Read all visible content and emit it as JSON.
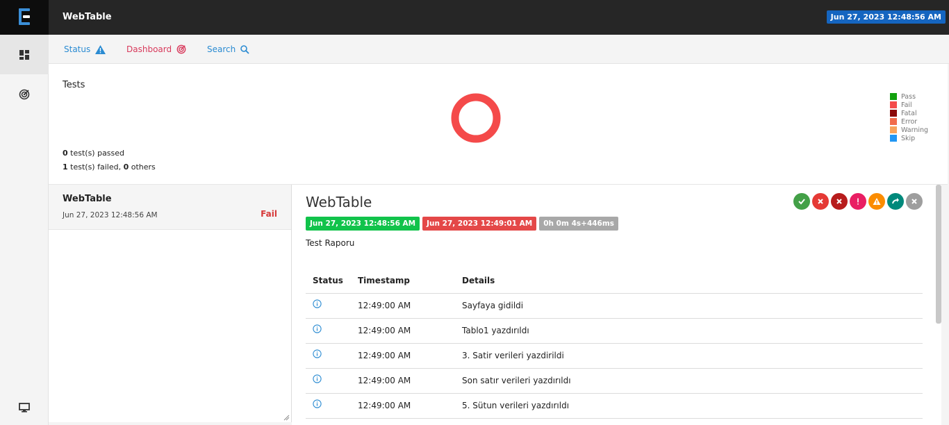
{
  "header": {
    "app_title": "WebTable",
    "date": "Jun 27, 2023 12:48:56 AM"
  },
  "sidenav": {
    "items": [
      {
        "icon": "dashboard-grid-icon",
        "active": true
      },
      {
        "icon": "radar-icon",
        "active": false
      },
      {
        "icon": "monitor-icon",
        "active": false
      }
    ]
  },
  "subnav": {
    "status_label": "Status",
    "dashboard_label": "Dashboard",
    "search_label": "Search"
  },
  "dashboard": {
    "title": "Tests",
    "passed_count": "0",
    "passed_text": " test(s) passed",
    "failed_count": "1",
    "failed_text": " test(s) failed, ",
    "others_count": "0",
    "others_text": " others",
    "legend": [
      {
        "label": "Pass",
        "color": "#13a10e"
      },
      {
        "label": "Fail",
        "color": "#f44a4a"
      },
      {
        "label": "Fatal",
        "color": "#8b0a0a"
      },
      {
        "label": "Error",
        "color": "#f16b4b"
      },
      {
        "label": "Warning",
        "color": "#f7a35c"
      },
      {
        "label": "Skip",
        "color": "#2196f3"
      }
    ],
    "chart_data": {
      "type": "pie",
      "categories": [
        "Pass",
        "Fail",
        "Fatal",
        "Error",
        "Warning",
        "Skip"
      ],
      "values": [
        0,
        1,
        0,
        0,
        0,
        0
      ]
    }
  },
  "test_list": {
    "items": [
      {
        "name": "WebTable",
        "time": "Jun 27, 2023 12:48:56 AM",
        "status": "Fail"
      }
    ]
  },
  "detail": {
    "title": "WebTable",
    "start_time": "Jun 27, 2023 12:48:56 AM",
    "end_time": "Jun 27, 2023 12:49:01 AM",
    "duration": "0h 0m 4s+446ms",
    "description": "Test Raporu",
    "filters": [
      {
        "name": "pass-filter",
        "color": "#43a047",
        "icon": "check"
      },
      {
        "name": "fail-filter",
        "color": "#e53935",
        "icon": "x"
      },
      {
        "name": "fatal-filter",
        "color": "#b71c1c",
        "icon": "x"
      },
      {
        "name": "error-filter",
        "color": "#e91e63",
        "icon": "!"
      },
      {
        "name": "warning-filter",
        "color": "#fb8c00",
        "icon": "triangle"
      },
      {
        "name": "skip-filter",
        "color": "#00897b",
        "icon": "redo"
      },
      {
        "name": "clear-filter",
        "color": "#9e9e9e",
        "icon": "x"
      }
    ],
    "table": {
      "headers": [
        "Status",
        "Timestamp",
        "Details"
      ],
      "rows": [
        {
          "time": "12:49:00 AM",
          "details": "Sayfaya gidildi"
        },
        {
          "time": "12:49:00 AM",
          "details": "Tablo1 yazdırıldı"
        },
        {
          "time": "12:49:00 AM",
          "details": "3. Satir verileri yazdirildi"
        },
        {
          "time": "12:49:00 AM",
          "details": "Son satır verileri yazdırıldı"
        },
        {
          "time": "12:49:00 AM",
          "details": "5. Sütun verileri yazdırıldı"
        }
      ]
    }
  }
}
